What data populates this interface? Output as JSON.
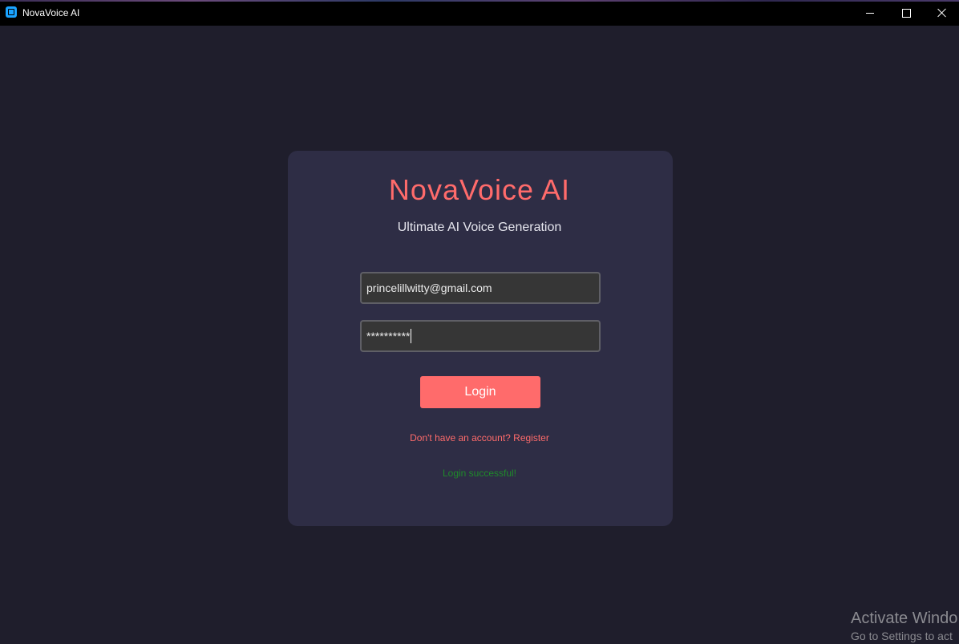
{
  "window": {
    "title": "NovaVoice AI",
    "icon": "app-icon",
    "controls": {
      "minimize_icon": "minimize-icon",
      "maximize_icon": "maximize-icon",
      "close_icon": "close-icon"
    }
  },
  "login_card": {
    "title": "NovaVoice AI",
    "subtitle": "Ultimate AI Voice Generation",
    "email_value": "princelillwitty@gmail.com",
    "password_masked": "**********",
    "login_label": "Login",
    "register_link": "Don't have an account? Register",
    "status_message": "Login successful!"
  },
  "watermark": {
    "title": "Activate Windo",
    "subtitle": "Go to Settings to act"
  },
  "colors": {
    "background": "#1f1e2c",
    "card": "#2e2d45",
    "accent": "#ff6b6b",
    "success": "#1f8a2a"
  }
}
